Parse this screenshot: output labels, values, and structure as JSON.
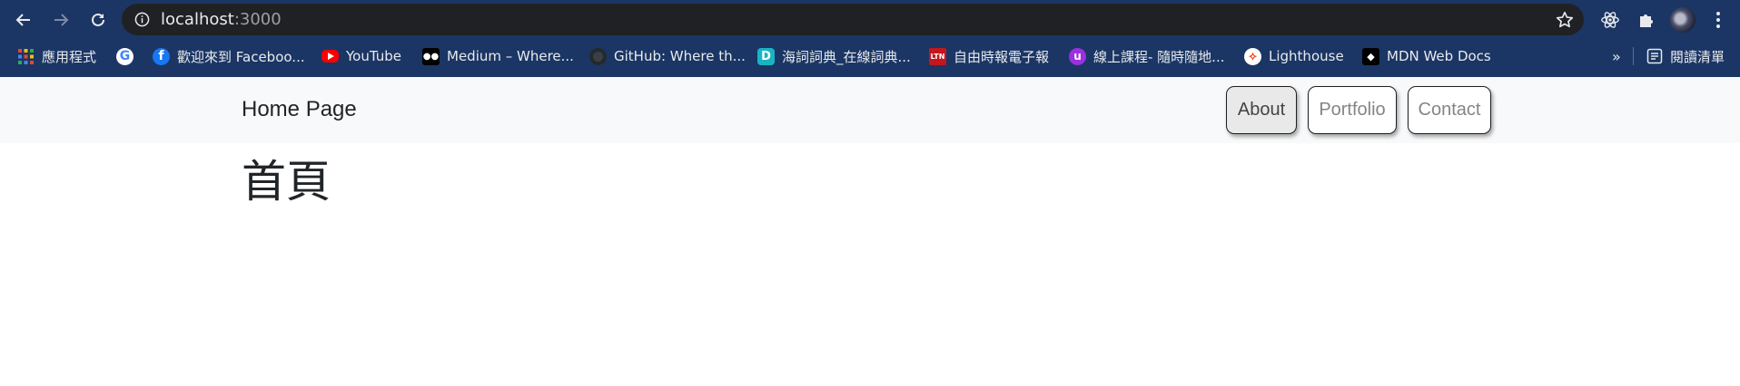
{
  "browser": {
    "url_host": "localhost",
    "url_port": ":3000"
  },
  "bookmarks": [
    {
      "label": "應用程式",
      "icon": "apps-grid-icon"
    },
    {
      "label": "",
      "icon": "google-icon"
    },
    {
      "label": "歡迎來到 Faceboo...",
      "icon": "facebook-icon"
    },
    {
      "label": "YouTube",
      "icon": "youtube-icon"
    },
    {
      "label": "Medium – Where...",
      "icon": "medium-icon"
    },
    {
      "label": "GitHub: Where th...",
      "icon": "github-icon"
    },
    {
      "label": "海詞詞典_在線詞典...",
      "icon": "dict-icon"
    },
    {
      "label": "自由時報電子報",
      "icon": "ltn-icon"
    },
    {
      "label": "線上課程- 隨時隨地...",
      "icon": "course-icon"
    },
    {
      "label": "Lighthouse",
      "icon": "lighthouse-icon"
    },
    {
      "label": "MDN Web Docs",
      "icon": "mdn-icon"
    }
  ],
  "bookmarks_overflow": "»",
  "reading_list": "閱讀清單",
  "navbar": {
    "brand": "Home Page",
    "links": [
      {
        "label": "About",
        "active": true
      },
      {
        "label": "Portfolio",
        "active": false
      },
      {
        "label": "Contact",
        "active": false
      }
    ]
  },
  "main": {
    "heading": "首頁"
  },
  "colors": {
    "chrome": "#1b3664",
    "omnibox": "#202124",
    "navbar_bg": "#f8f9fa"
  }
}
